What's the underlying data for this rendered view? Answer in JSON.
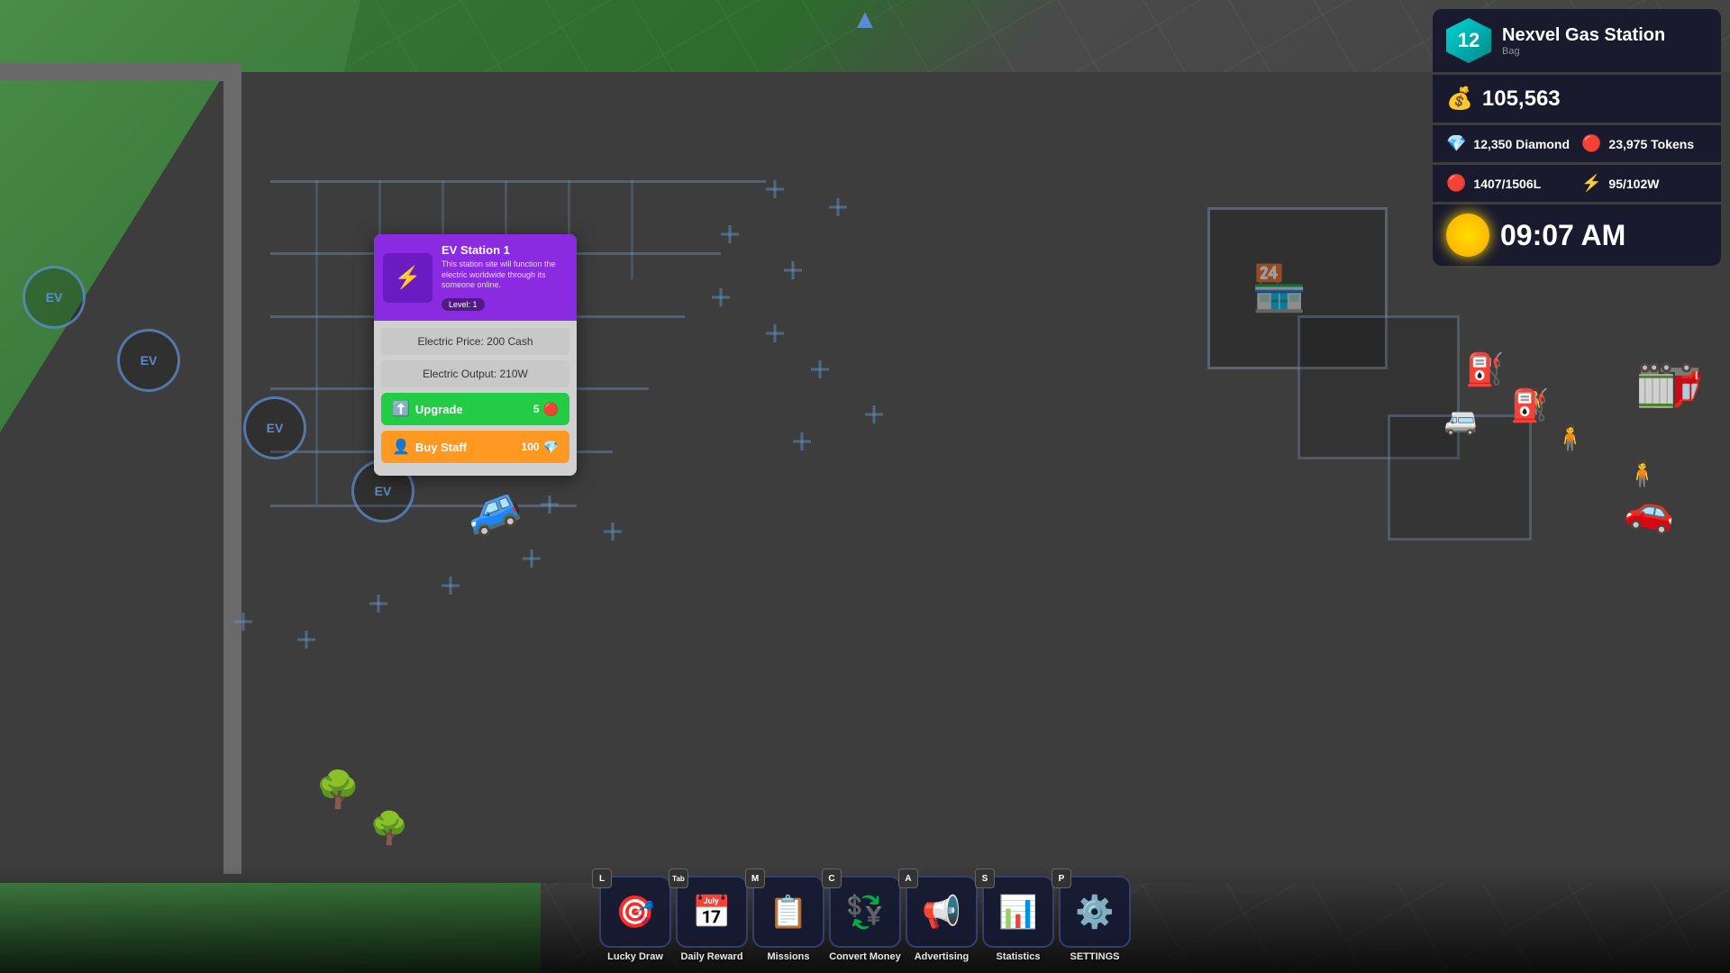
{
  "game": {
    "station_name": "Nexvel Gas Station",
    "station_level": 12,
    "sub_label": "Bag",
    "cash": "105,563",
    "diamond_label": "12,350 Diamond",
    "tokens_label": "23,975 Tokens",
    "fuel_label": "1407/1506L",
    "energy_label": "95/102W",
    "time": "09:07 AM"
  },
  "popup": {
    "title": "EV Station 1",
    "description": "This station site will function the electric worldwide through its someone online.",
    "level": "Level: 1",
    "electric_price": "Electric Price: 200 Cash",
    "electric_output": "Electric Output: 210W",
    "upgrade_label": "Upgrade",
    "upgrade_cost": "5",
    "buy_staff_label": "Buy Staff",
    "buy_staff_cost": "100"
  },
  "toolbar": {
    "buttons": [
      {
        "key": "L",
        "label": "Lucky Draw",
        "icon": "🎯",
        "shortcut": "L"
      },
      {
        "key": "Tab",
        "label": "Daily Reward",
        "icon": "📅",
        "shortcut": "Tab"
      },
      {
        "key": "M",
        "label": "Missions",
        "icon": "📋",
        "shortcut": "M"
      },
      {
        "key": "C",
        "label": "Convert Money",
        "icon": "💱",
        "shortcut": "C"
      },
      {
        "key": "A",
        "label": "Advertising",
        "icon": "📢",
        "shortcut": "A"
      },
      {
        "key": "S",
        "label": "Statistics",
        "icon": "📊",
        "shortcut": "S"
      },
      {
        "key": "P",
        "label": "SETTINGS",
        "icon": "⚙️",
        "shortcut": "P"
      }
    ]
  },
  "colors": {
    "hud_bg": "#1a1a2e",
    "accent_teal": "#00d4d4",
    "accent_purple": "#8a2be2",
    "accent_green": "#22cc44",
    "accent_orange": "#ff9922",
    "road": "#383838",
    "grass": "#3a7a3a"
  }
}
